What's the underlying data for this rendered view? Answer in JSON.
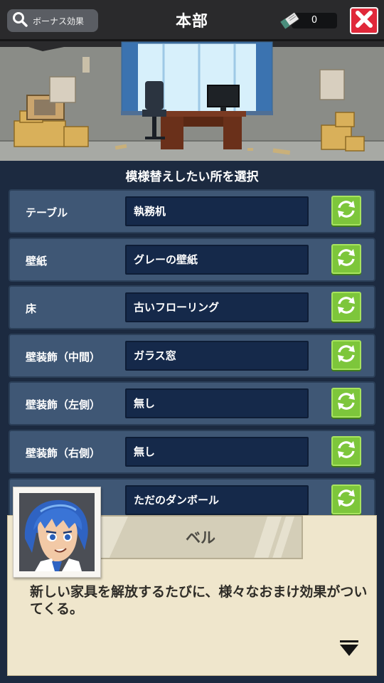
{
  "header": {
    "bonus_label": "ボーナス効果",
    "title": "本部",
    "token_count": "0"
  },
  "panel": {
    "heading": "模様替えしたい所を選択",
    "rows": [
      {
        "label": "テーブル",
        "value": "執務机"
      },
      {
        "label": "壁紙",
        "value": "グレーの壁紙"
      },
      {
        "label": "床",
        "value": "古いフローリング"
      },
      {
        "label": "壁装飾（中間）",
        "value": "ガラス窓"
      },
      {
        "label": "壁装飾（左側）",
        "value": "無し"
      },
      {
        "label": "壁装飾（右側）",
        "value": "無し"
      },
      {
        "label": "",
        "value": "ただのダンボール"
      }
    ]
  },
  "dialog": {
    "speaker": "ベル",
    "message": "新しい家具を解放するたびに、様々なおまけ効果がついてくる。"
  },
  "colors": {
    "accent_green": "#7dc63b",
    "close_red": "#e0283a",
    "panel_bg": "#1c2a40",
    "row_bg": "#3f5775",
    "field_bg": "#15294a"
  },
  "icons": [
    "search-icon",
    "ticket-icon",
    "close-icon",
    "swap-icon",
    "next-arrow-icon"
  ]
}
